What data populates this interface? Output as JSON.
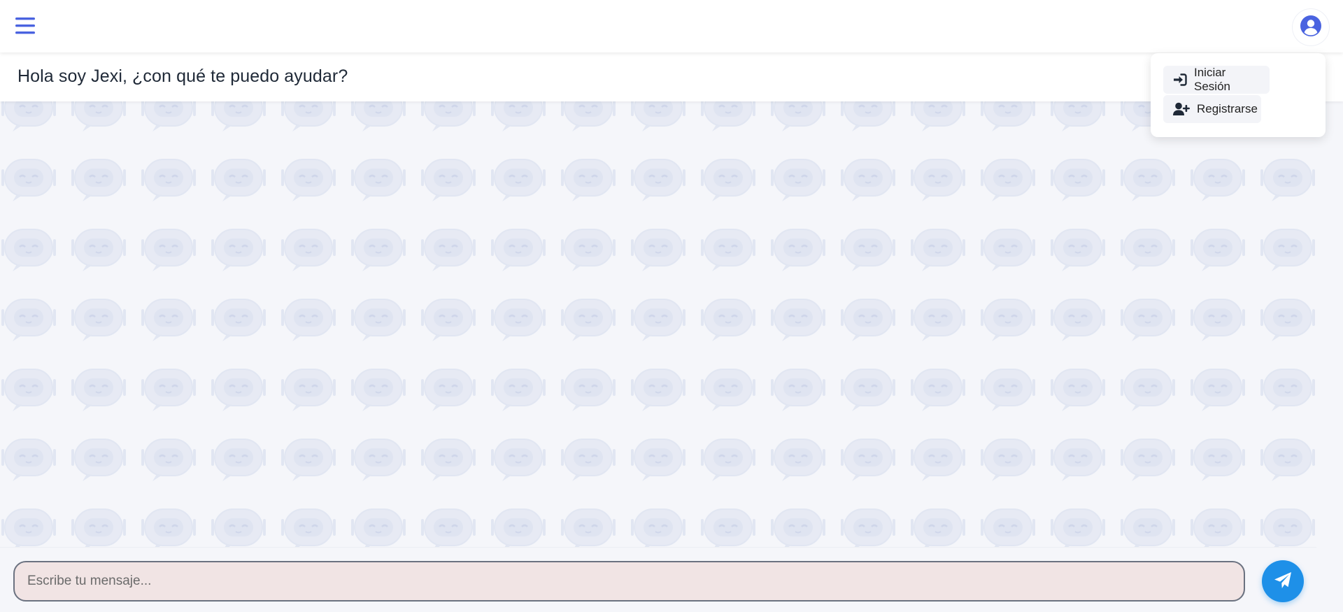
{
  "topbar": {
    "menu_icon": "hamburger-menu-icon",
    "avatar_icon": "user-circle-icon",
    "accent_color": "#4a63e0"
  },
  "header": {
    "title": "Hola soy Jexi, ¿con qué te puedo ayudar?"
  },
  "chat": {
    "background_pattern_icon": "robot-chat-bubble-icon",
    "pattern_color": "#e4e8f3"
  },
  "composer": {
    "placeholder": "Escribe tu mensaje...",
    "send_icon": "paper-plane-icon",
    "send_color": "#1e90e8"
  },
  "user_menu": {
    "items": [
      {
        "label": "Iniciar Sesión",
        "icon": "sign-in-icon"
      },
      {
        "label": "Registrarse",
        "icon": "user-plus-icon"
      }
    ]
  }
}
